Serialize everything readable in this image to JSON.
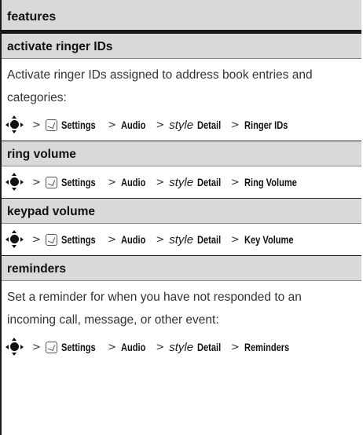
{
  "header": {
    "title": "features"
  },
  "sections": [
    {
      "title": "activate ringer IDs",
      "description": "Activate ringer IDs assigned to address book entries and categories:",
      "path": {
        "settings": "Settings",
        "audio": "Audio",
        "style": "style",
        "detail": "Detail",
        "item": "Ringer IDs"
      }
    },
    {
      "title": "ring volume",
      "path": {
        "settings": "Settings",
        "audio": "Audio",
        "style": "style",
        "detail": "Detail",
        "item": "Ring Volume"
      }
    },
    {
      "title": "keypad volume",
      "path": {
        "settings": "Settings",
        "audio": "Audio",
        "style": "style",
        "detail": "Detail",
        "item": "Key Volume"
      }
    },
    {
      "title": "reminders",
      "description": "Set a reminder for when you have not responded to an incoming call, message, or other event:",
      "path": {
        "settings": "Settings",
        "audio": "Audio",
        "style": "style",
        "detail": "Detail",
        "item": "Reminders"
      }
    }
  ],
  "separator": ">"
}
